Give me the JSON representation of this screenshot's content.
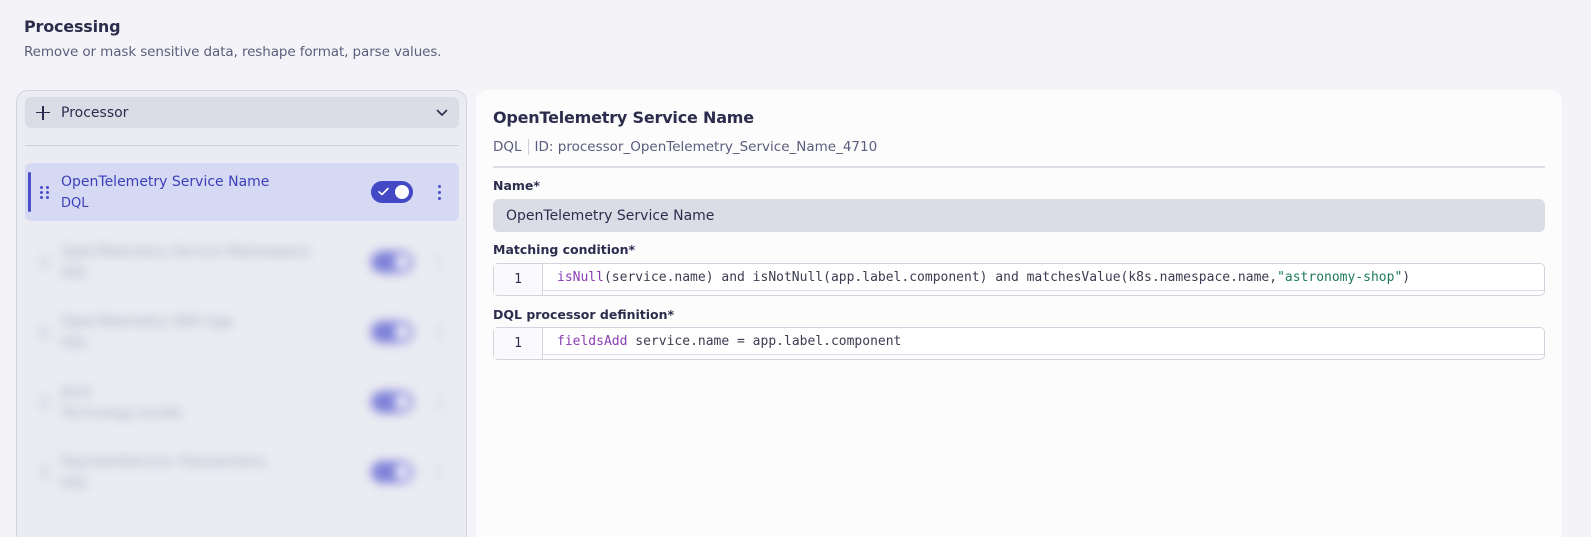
{
  "header": {
    "title": "Processing",
    "subtitle": "Remove or mask sensitive data, reshape format, parse values."
  },
  "left": {
    "dropdown_label": "Processor",
    "processors": [
      {
        "name": "OpenTelemetry Service Name",
        "type": "DQL",
        "enabled": true
      },
      {
        "name": "OpenTelemetry Service Namespace",
        "type": "DQL",
        "enabled": true
      },
      {
        "name": "OpenTelemetry SDK logs",
        "type": "DQL",
        "enabled": true
      },
      {
        "name": "Java",
        "type": "Technology bundle",
        "enabled": true
      },
      {
        "name": "PaymentService Transactions",
        "type": "DQL",
        "enabled": true
      }
    ]
  },
  "detail": {
    "title": "OpenTelemetry Service Name",
    "type": "DQL",
    "id_text": "ID: processor_OpenTelemetry_Service_Name_4710",
    "name_label": "Name*",
    "name_value": "OpenTelemetry Service Name",
    "matching_label": "Matching condition*",
    "matching_line_number": "1",
    "matching_code": {
      "fn1": "isNull",
      "part1": "(service.name) and isNotNull(app.label.component) and matchesValue(k8s.namespace.name,",
      "string": "\"astronomy-shop\"",
      "part2": ")"
    },
    "dql_label": "DQL processor definition*",
    "dql_line_number": "1",
    "dql_code": {
      "keyword": "fieldsAdd",
      "rest": " service.name = app.label.component"
    }
  },
  "colors": {
    "accent": "#4448c4",
    "keyword": "#8a3eb3",
    "string": "#1c7a5a"
  }
}
